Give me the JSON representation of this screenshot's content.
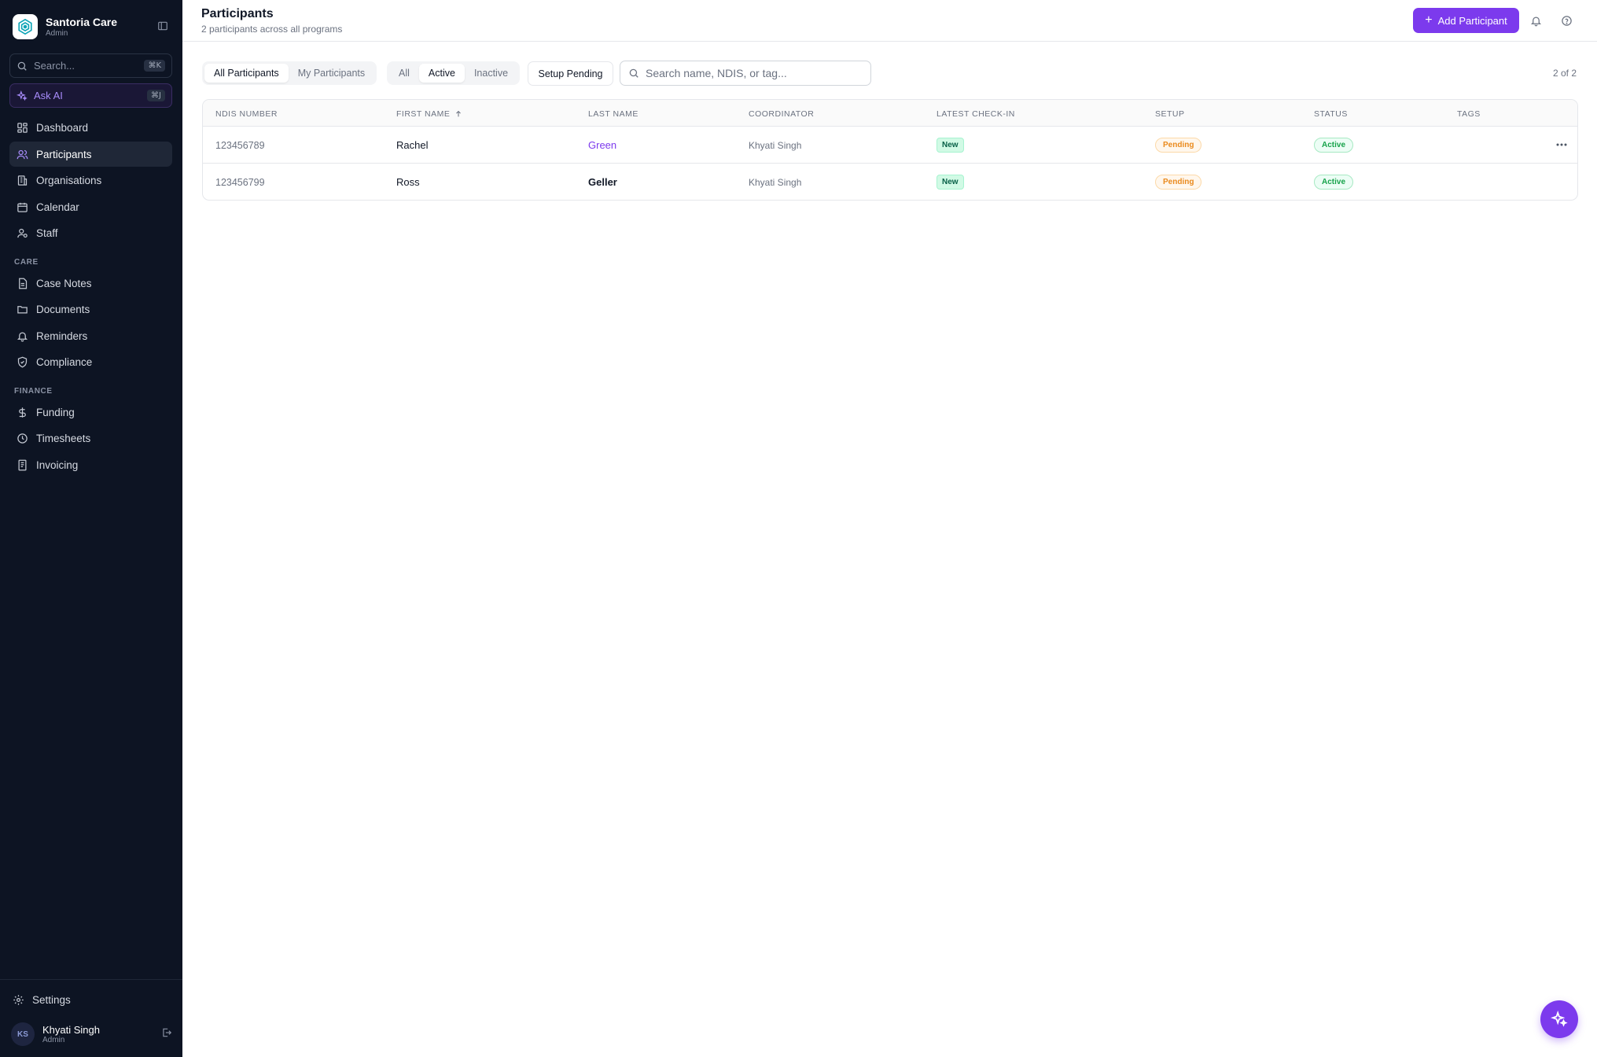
{
  "app": {
    "name": "Santoria Care",
    "role": "Admin"
  },
  "sidebar": {
    "search_label": "Search...",
    "search_shortcut": "⌘K",
    "ask_ai_label": "Ask AI",
    "ask_ai_shortcut": "⌘J",
    "main_items": [
      {
        "label": "Dashboard",
        "icon": "dashboard-icon"
      },
      {
        "label": "Participants",
        "icon": "users-icon",
        "active": true
      },
      {
        "label": "Organisations",
        "icon": "building-icon"
      },
      {
        "label": "Calendar",
        "icon": "calendar-icon"
      },
      {
        "label": "Staff",
        "icon": "staff-icon"
      }
    ],
    "care_label": "CARE",
    "care_items": [
      {
        "label": "Case Notes",
        "icon": "notes-icon"
      },
      {
        "label": "Documents",
        "icon": "folder-icon"
      },
      {
        "label": "Reminders",
        "icon": "bell-icon"
      },
      {
        "label": "Compliance",
        "icon": "shield-icon"
      }
    ],
    "finance_label": "FINANCE",
    "finance_items": [
      {
        "label": "Funding",
        "icon": "dollar-icon"
      },
      {
        "label": "Timesheets",
        "icon": "clock-icon"
      },
      {
        "label": "Invoicing",
        "icon": "invoice-icon"
      }
    ],
    "settings_label": "Settings",
    "user": {
      "initials": "KS",
      "name": "Khyati Singh",
      "role": "Admin"
    }
  },
  "header": {
    "title": "Participants",
    "subtitle": "2 participants across all programs",
    "add_button": "Add Participant"
  },
  "filters": {
    "scope_tabs": [
      "All Participants",
      "My Participants"
    ],
    "scope_selected": "All Participants",
    "status_tabs": [
      "All",
      "Active",
      "Inactive"
    ],
    "status_selected": "Active",
    "setup_pending": "Setup Pending",
    "search_placeholder": "Search name, NDIS, or tag...",
    "count": "2 of 2"
  },
  "table": {
    "columns": [
      "NDIS NUMBER",
      "FIRST NAME",
      "LAST NAME",
      "COORDINATOR",
      "LATEST CHECK-IN",
      "SETUP",
      "STATUS",
      "TAGS"
    ],
    "rows": [
      {
        "ndis": "123456789",
        "first": "Rachel",
        "last": "Green",
        "coordinator": "Khyati Singh",
        "checkin": "New",
        "setup": "Pending",
        "status": "Active"
      },
      {
        "ndis": "123456799",
        "first": "Ross",
        "last": "Geller",
        "coordinator": "Khyati Singh",
        "checkin": "New",
        "setup": "Pending",
        "status": "Active"
      }
    ]
  },
  "colors": {
    "accent": "#7c3aed",
    "sidebar_bg": "#0d1423"
  }
}
